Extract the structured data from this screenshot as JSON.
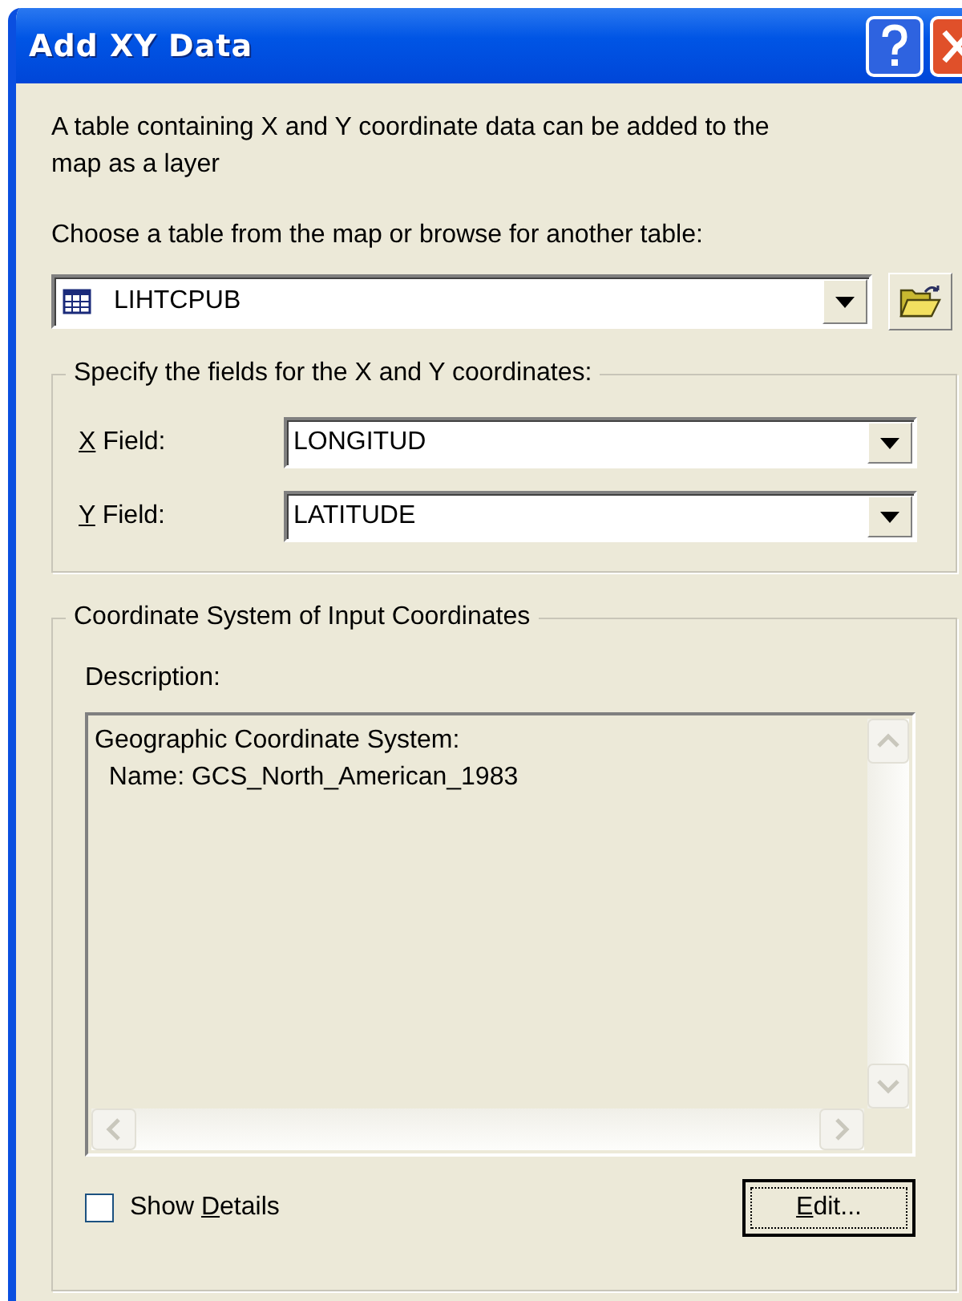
{
  "window": {
    "title": "Add XY Data"
  },
  "intro": "A table containing X and Y coordinate data can be added to the map as a layer",
  "table_prompt": "Choose a table from the map or browse for another table:",
  "table_combo": {
    "value": "LIHTCPUB"
  },
  "fields_group": {
    "legend": "Specify the fields for the X and Y coordinates:",
    "fields": [
      {
        "label": "X Field:",
        "value": "LONGITUD"
      },
      {
        "label": "Y Field:",
        "value": "LATITUDE"
      }
    ]
  },
  "coord_group": {
    "legend": "Coordinate System of Input Coordinates",
    "description_label": "Description:",
    "description_lines": [
      "Geographic Coordinate System:",
      "  Name: GCS_North_American_1983"
    ],
    "show_details": {
      "label": "Show Details",
      "checked": false
    },
    "edit_button": {
      "label": "Edit..."
    }
  }
}
